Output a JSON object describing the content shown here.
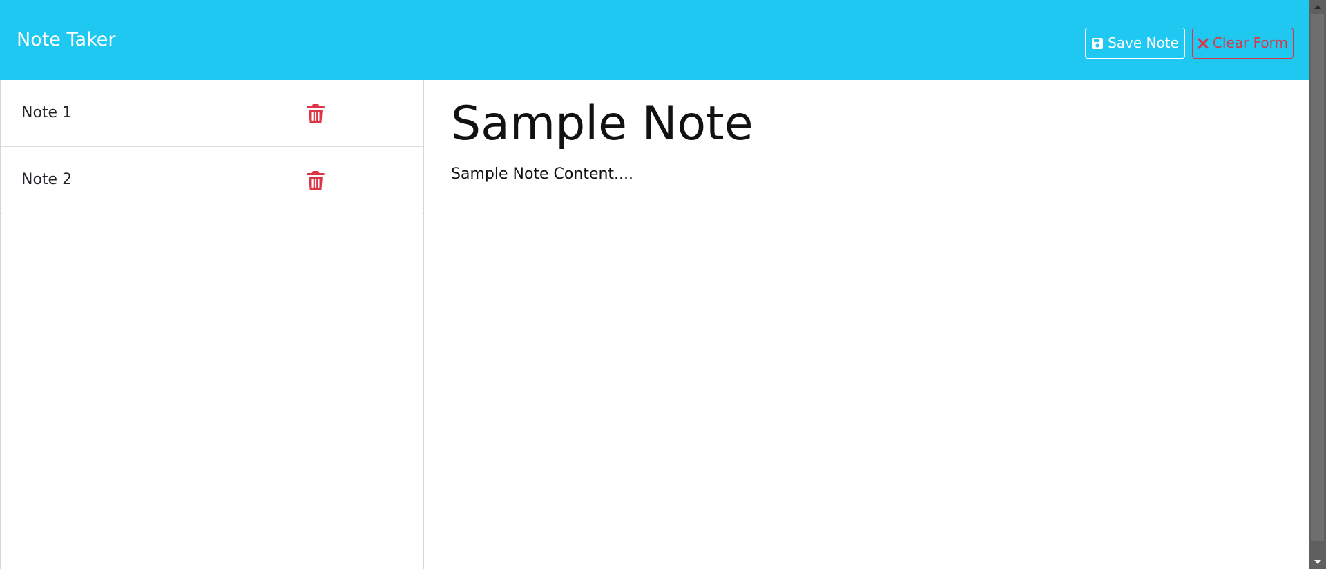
{
  "header": {
    "brand": "Note Taker",
    "save_label": "Save Note",
    "clear_label": "Clear Form"
  },
  "sidebar": {
    "notes": [
      {
        "title": "Note 1"
      },
      {
        "title": "Note 2"
      }
    ]
  },
  "main": {
    "title": "Sample Note",
    "content": "Sample Note Content...."
  },
  "icons": {
    "save": "floppy-disk-icon",
    "clear": "x-icon",
    "delete": "trash-icon"
  },
  "colors": {
    "navbar": "#1ec8f0",
    "danger": "#dc3545",
    "scrollbar": "#5f5f5f"
  }
}
